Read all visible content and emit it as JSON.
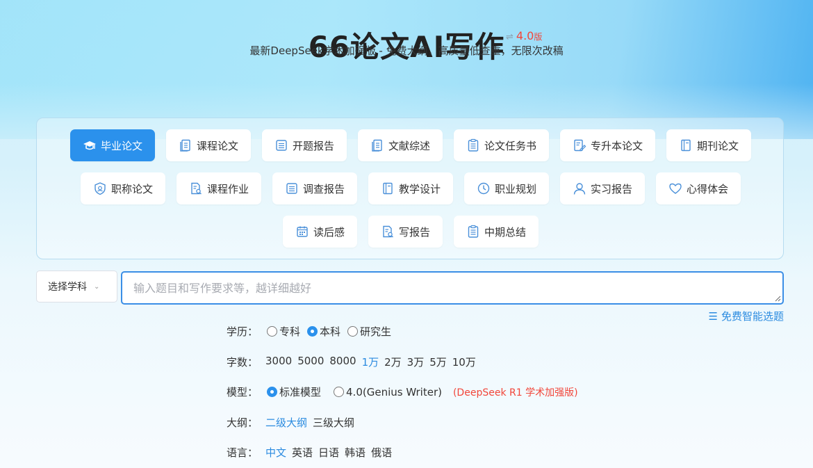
{
  "header": {
    "title": "66论文AI写作",
    "version_swap": "⇌",
    "version": "4.0",
    "version_suffix": "版",
    "subtitle": "最新DeepSeek学术加强版 - 免费大纲，高质量低查重，无限次改稿"
  },
  "categories": {
    "row1": [
      {
        "label": "毕业论文",
        "icon": "graduation-cap-icon",
        "active": true
      },
      {
        "label": "课程论文",
        "icon": "document-icon"
      },
      {
        "label": "开题报告",
        "icon": "list-icon"
      },
      {
        "label": "文献综述",
        "icon": "document-icon"
      },
      {
        "label": "论文任务书",
        "icon": "clipboard-icon"
      },
      {
        "label": "专升本论文",
        "icon": "edit-document-icon"
      },
      {
        "label": "期刊论文",
        "icon": "book-icon"
      }
    ],
    "row2": [
      {
        "label": "职称论文",
        "icon": "shield-icon"
      },
      {
        "label": "课程作业",
        "icon": "document-search-icon"
      },
      {
        "label": "调查报告",
        "icon": "list-icon"
      },
      {
        "label": "教学设计",
        "icon": "book-icon"
      },
      {
        "label": "职业规划",
        "icon": "clock-icon"
      },
      {
        "label": "实习报告",
        "icon": "user-icon"
      },
      {
        "label": "心得体会",
        "icon": "heart-icon"
      }
    ],
    "row3": [
      {
        "label": "读后感",
        "icon": "calendar-icon"
      },
      {
        "label": "写报告",
        "icon": "document-search-icon"
      },
      {
        "label": "中期总结",
        "icon": "clipboard-icon"
      }
    ]
  },
  "subject_select": {
    "label": "选择学科",
    "chevron": "⌄"
  },
  "topic_input": {
    "placeholder": "输入题目和写作要求等，越详细越好",
    "value": ""
  },
  "smart_topic": {
    "icon": "☰",
    "label": "免费智能选题"
  },
  "education": {
    "label": "学历：",
    "options": [
      {
        "label": "专科",
        "selected": false
      },
      {
        "label": "本科",
        "selected": true
      },
      {
        "label": "研究生",
        "selected": false
      }
    ]
  },
  "word_count": {
    "label": "字数：",
    "options": [
      {
        "label": "3000",
        "selected": false
      },
      {
        "label": "5000",
        "selected": false
      },
      {
        "label": "8000",
        "selected": false
      },
      {
        "label": "1万",
        "selected": true
      },
      {
        "label": "2万",
        "selected": false
      },
      {
        "label": "3万",
        "selected": false
      },
      {
        "label": "5万",
        "selected": false
      },
      {
        "label": "10万",
        "selected": false
      }
    ]
  },
  "model": {
    "label": "模型：",
    "options": [
      {
        "label": "标准模型",
        "selected": true
      },
      {
        "label": "4.0(Genius Writer)",
        "selected": false
      }
    ],
    "note": "(DeepSeek R1 学术加强版)"
  },
  "outline": {
    "label": "大纲：",
    "options": [
      {
        "label": "二级大纲",
        "selected": true
      },
      {
        "label": "三级大纲",
        "selected": false
      }
    ]
  },
  "language": {
    "label": "语言：",
    "options": [
      {
        "label": "中文",
        "selected": true
      },
      {
        "label": "英语",
        "selected": false
      },
      {
        "label": "日语",
        "selected": false
      },
      {
        "label": "韩语",
        "selected": false
      },
      {
        "label": "俄语",
        "selected": false
      }
    ]
  },
  "colors": {
    "accent": "#2b91ec",
    "link": "#2b8be0",
    "warning": "#f2463a"
  }
}
